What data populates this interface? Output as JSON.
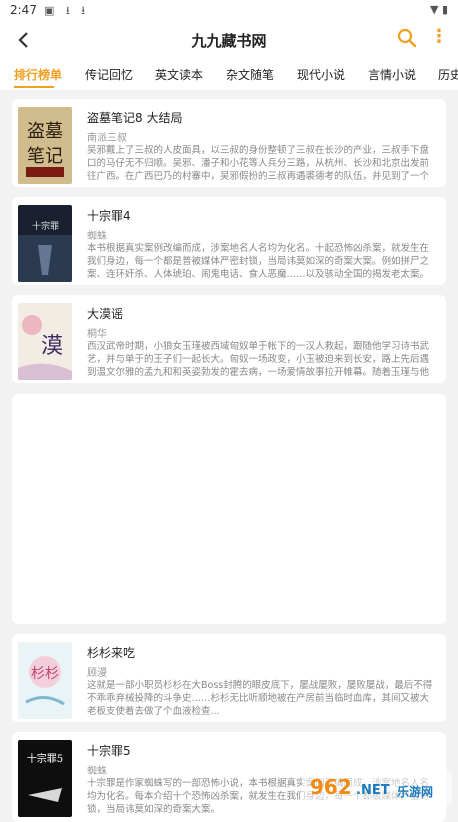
{
  "status": {
    "time": "2:47"
  },
  "app": {
    "title": "九九藏书网"
  },
  "tabs": [
    "排行榜单",
    "传记回忆",
    "英文读本",
    "杂文随笔",
    "现代小说",
    "言情小说",
    "历史"
  ],
  "books": [
    {
      "title": "盗墓笔记8 大结局",
      "author": "南派三叔",
      "desc": "吴邪戴上了三叔的人皮面具，以三叔的身份整顿了三叔在长沙的产业，三叔手下盘口的马仔无不归顺。吴邪、潘子和小花等人兵分三路，从杭州、长沙和北京出发前往广西。在广西巴乃的村寨中，吴邪假扮的三叔再遇裘德考的队伍，并见到了一个很眼熟化妆..."
    },
    {
      "title": "十宗罪4",
      "author": "蜘蛛",
      "desc": "本书根据真实案例改编而成，涉案地名人名均为化名。十起恐怖凶杀案，就发生在我们身边，每一个都是普被媒体严密封锁，当局讳莫如深的奇案大案。例如拼尸之案、连环奸杀、人体琥珀、闹鬼电话、食人恶魔……以及骇动全国的揭发老太案。四个超级警察..."
    },
    {
      "title": "大漠谣",
      "author": "桐华",
      "desc": "西汉武帝时期，小狼女玉瑾被西域匈奴单于帐下的一汉人救起，跟随他学习诗书武艺，并与单于的王子们一起长大。匈奴一场政变，小玉被迫来到长安，路上先后遇到温文尔雅的孟九和和英姿勃发的霍去病，一场爱情故事拉开帷幕。随着玉瑾与他们的一次次..."
    },
    {
      "title": "杉杉来吃",
      "author": "顾漫",
      "desc": "这就是一部小职员杉杉在大Boss封腾的眼皮底下，屡战屡败，屡败屡战，最后不得不乖乖弃械投降的斗争史……杉杉无比听顺地被在产房前当临时血库，其间又被大老板支使着去做了个血液检查..."
    },
    {
      "title": "十宗罪5",
      "author": "蜘蛛",
      "desc": "十宗罪是作家蜘蛛写的一部恐怖小说，本书根据真实案例改编而成，涉案地名人名均为化名。每本介绍十个恐怖凶杀案，就发生在我们身边，每一个都被媒体严密封锁，当局讳莫如深的奇案大案。"
    }
  ],
  "colors": {
    "accent": "#f0a020",
    "background": "#f2f2f2"
  },
  "icons": [
    "back-arrow-icon",
    "search-icon",
    "more-vertical-icon"
  ],
  "watermark": {
    "text": "962.NET 乐游网"
  }
}
